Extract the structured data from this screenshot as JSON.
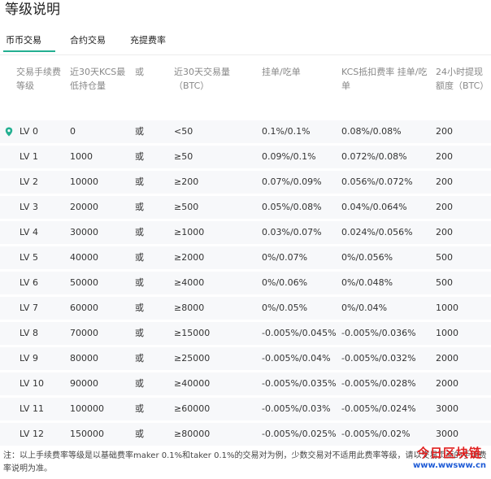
{
  "page_title": "等级说明",
  "tabs": [
    {
      "label": "币币交易",
      "active": true
    },
    {
      "label": "合约交易",
      "active": false
    },
    {
      "label": "充提费率",
      "active": false
    }
  ],
  "headers": {
    "level": "交易手续费等级",
    "kcs": "近30天KCS最低持仓量",
    "or": "或",
    "volume": "近30天交易量（BTC）",
    "maker_taker": "挂单/吃单",
    "kcs_discount": "KCS抵扣费率 挂单/吃单",
    "withdraw": "24小时提现额度（BTC）"
  },
  "accent_color": "#23af91",
  "current_level_icon": "location-pin-icon",
  "rows": [
    {
      "level": "LV 0",
      "kcs": "0",
      "or": "或",
      "volume": "<50",
      "fee": "0.1%/0.1%",
      "kcs_fee": "0.08%/0.08%",
      "withdraw": "200"
    },
    {
      "level": "LV 1",
      "kcs": "1000",
      "or": "或",
      "volume": "≥50",
      "fee": "0.09%/0.1%",
      "kcs_fee": "0.072%/0.08%",
      "withdraw": "200"
    },
    {
      "level": "LV 2",
      "kcs": "10000",
      "or": "或",
      "volume": "≥200",
      "fee": "0.07%/0.09%",
      "kcs_fee": "0.056%/0.072%",
      "withdraw": "200"
    },
    {
      "level": "LV 3",
      "kcs": "20000",
      "or": "或",
      "volume": "≥500",
      "fee": "0.05%/0.08%",
      "kcs_fee": "0.04%/0.064%",
      "withdraw": "200"
    },
    {
      "level": "LV 4",
      "kcs": "30000",
      "or": "或",
      "volume": "≥1000",
      "fee": "0.03%/0.07%",
      "kcs_fee": "0.024%/0.056%",
      "withdraw": "200"
    },
    {
      "level": "LV 5",
      "kcs": "40000",
      "or": "或",
      "volume": "≥2000",
      "fee": "0%/0.07%",
      "kcs_fee": "0%/0.056%",
      "withdraw": "500"
    },
    {
      "level": "LV 6",
      "kcs": "50000",
      "or": "或",
      "volume": "≥4000",
      "fee": "0%/0.06%",
      "kcs_fee": "0%/0.048%",
      "withdraw": "500"
    },
    {
      "level": "LV 7",
      "kcs": "60000",
      "or": "或",
      "volume": "≥8000",
      "fee": "0%/0.05%",
      "kcs_fee": "0%/0.04%",
      "withdraw": "1000"
    },
    {
      "level": "LV 8",
      "kcs": "70000",
      "or": "或",
      "volume": "≥15000",
      "fee": "-0.005%/0.045%",
      "kcs_fee": "-0.005%/0.036%",
      "withdraw": "1000"
    },
    {
      "level": "LV 9",
      "kcs": "80000",
      "or": "或",
      "volume": "≥25000",
      "fee": "-0.005%/0.04%",
      "kcs_fee": "-0.005%/0.032%",
      "withdraw": "2000"
    },
    {
      "level": "LV 10",
      "kcs": "90000",
      "or": "或",
      "volume": "≥40000",
      "fee": "-0.005%/0.035%",
      "kcs_fee": "-0.005%/0.028%",
      "withdraw": "2000"
    },
    {
      "level": "LV 11",
      "kcs": "100000",
      "or": "或",
      "volume": "≥60000",
      "fee": "-0.005%/0.03%",
      "kcs_fee": "-0.005%/0.024%",
      "withdraw": "3000"
    },
    {
      "level": "LV 12",
      "kcs": "150000",
      "or": "或",
      "volume": "≥80000",
      "fee": "-0.005%/0.025%",
      "kcs_fee": "-0.005%/0.02%",
      "withdraw": "3000"
    }
  ],
  "note": "注：以上手续费率等级是以基础费率maker 0.1%和taker 0.1%的交易对为例，少数交易对不适用此费率等级，请以交易页面的手续费率说明为准。",
  "watermark": {
    "brand": "今日区块链",
    "url": "www.wwsww.cn"
  }
}
